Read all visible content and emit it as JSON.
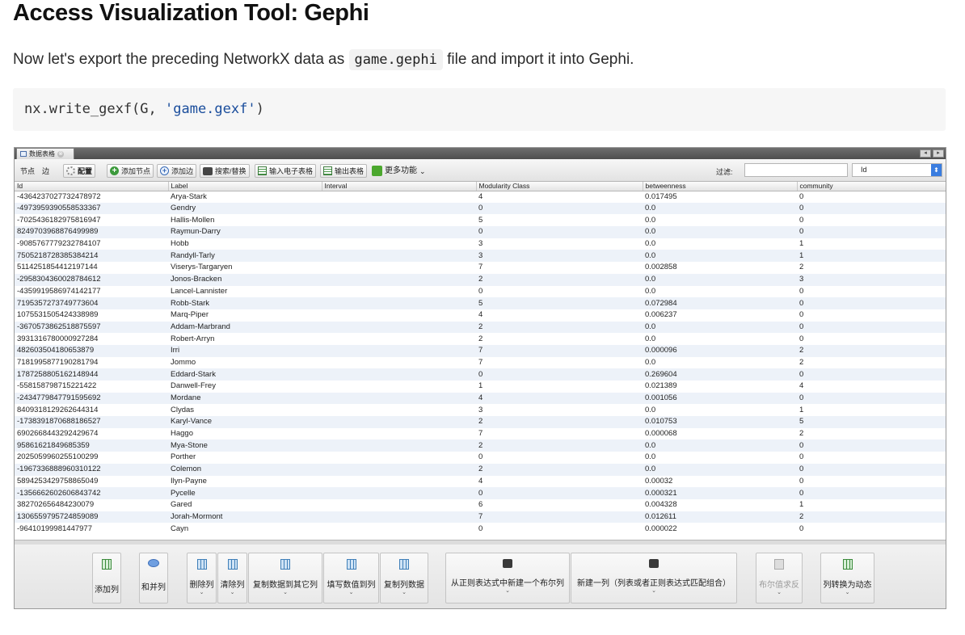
{
  "article": {
    "heading": "Access Visualization Tool: Gephi",
    "para_before": "Now let's export the preceding NetworkX data as",
    "para_code": "game.gephi",
    "para_after": "file and import it into Gephi.",
    "code_prefix": "nx.write_gexf(G, ",
    "code_string": "'game.gexf'",
    "code_suffix": ")"
  },
  "window": {
    "tab_title": "数据表格",
    "tab_close": "⊗",
    "ctrl_prev": "◂",
    "ctrl_next": "▸"
  },
  "toolbar": {
    "nodes": "节点",
    "edges": "边",
    "config": "配置",
    "add_node": "添加节点",
    "add_edge": "添加边",
    "search_replace": "搜索/替换",
    "import_sheet": "输入电子表格",
    "export_table": "输出表格",
    "more": "更多功能",
    "more_arrow": "⌄",
    "filter_label": "过滤:",
    "filter_value": "",
    "filter_column": "Id",
    "filter_arrow": "⬍"
  },
  "table": {
    "columns": [
      "Id",
      "Label",
      "Interval",
      "Modularity Class",
      "betweenness",
      "community"
    ],
    "rows": [
      [
        "-436423702773247897​2",
        "Arya-Stark",
        "",
        "4",
        "0.017495",
        "0"
      ],
      [
        "-4973959390558533367",
        "Gendry",
        "",
        "0",
        "0.0",
        "0"
      ],
      [
        "-7025436182975816947",
        "Hallis-Mollen",
        "",
        "5",
        "0.0",
        "0"
      ],
      [
        "8249703968876499989",
        "Raymun-Darry",
        "",
        "0",
        "0.0",
        "0"
      ],
      [
        "-9085767779232784107",
        "Hobb",
        "",
        "3",
        "0.0",
        "1"
      ],
      [
        "7505218728385384214",
        "Randyll-Tarly",
        "",
        "3",
        "0.0",
        "1"
      ],
      [
        "5114251854412197144",
        "Viserys-Targaryen",
        "",
        "7",
        "0.002858",
        "2"
      ],
      [
        "-2958304360028784612",
        "Jonos-Bracken",
        "",
        "2",
        "0.0",
        "3"
      ],
      [
        "-4359919586974142177",
        "Lancel-Lannister",
        "",
        "0",
        "0.0",
        "0"
      ],
      [
        "7195357273749773604",
        "Robb-Stark",
        "",
        "5",
        "0.072984",
        "0"
      ],
      [
        "1075531505424338989",
        "Marq-Piper",
        "",
        "4",
        "0.006237",
        "0"
      ],
      [
        "-3670573862518875597",
        "Addam-Marbrand",
        "",
        "2",
        "0.0",
        "0"
      ],
      [
        "3931316780000927284",
        "Robert-Arryn",
        "",
        "2",
        "0.0",
        "0"
      ],
      [
        "482603504180653879",
        "Irri",
        "",
        "7",
        "0.000096",
        "2"
      ],
      [
        "7181995877190281794",
        "Jommo",
        "",
        "7",
        "0.0",
        "2"
      ],
      [
        "1787258805162148944",
        "Eddard-Stark",
        "",
        "0",
        "0.269604",
        "0"
      ],
      [
        "-558158798715221422",
        "Danwell-Frey",
        "",
        "1",
        "0.021389",
        "4"
      ],
      [
        "-2434779847791595692",
        "Mordane",
        "",
        "4",
        "0.001056",
        "0"
      ],
      [
        "8409318129262644314",
        "Clydas",
        "",
        "3",
        "0.0",
        "1"
      ],
      [
        "-1738391870688186527",
        "Karyl-Vance",
        "",
        "2",
        "0.010753",
        "5"
      ],
      [
        "6902668443292429674",
        "Haggo",
        "",
        "7",
        "0.000068",
        "2"
      ],
      [
        "95861621849685359",
        "Mya-Stone",
        "",
        "2",
        "0.0",
        "0"
      ],
      [
        "2025059960255100299",
        "Porther",
        "",
        "0",
        "0.0",
        "0"
      ],
      [
        "-1967336888960310122",
        "Colemon",
        "",
        "2",
        "0.0",
        "0"
      ],
      [
        "5894253429758865049",
        "Ilyn-Payne",
        "",
        "4",
        "0.00032",
        "0"
      ],
      [
        "-1356662602606843742",
        "Pycelle",
        "",
        "0",
        "0.000321",
        "0"
      ],
      [
        "382702656484230079",
        "Gared",
        "",
        "6",
        "0.004328",
        "1"
      ],
      [
        "1306559795724859089",
        "Jorah-Mormont",
        "",
        "7",
        "0.012611",
        "2"
      ],
      [
        "-964101999814479​77",
        "Cayn",
        "",
        "0",
        "0.000022",
        "0"
      ]
    ]
  },
  "bottom_buttons": [
    {
      "label": "添加列",
      "arrow": ""
    },
    {
      "label": "和并列",
      "arrow": ""
    },
    {
      "label": "删除列",
      "arrow": "⌄"
    },
    {
      "label": "清除列",
      "arrow": "⌄"
    },
    {
      "label": "复制数据到其它列",
      "arrow": "⌄"
    },
    {
      "label": "填写数值到列",
      "arrow": "⌄"
    },
    {
      "label": "复制列数据",
      "arrow": "⌄"
    },
    {
      "label": "从正则表达式中新建一个布尔列",
      "arrow": "⌄"
    },
    {
      "label": "新建一列（列表或者正则表达式匹配组合）",
      "arrow": "⌄"
    },
    {
      "label": "布尔值求反",
      "arrow": "⌄"
    },
    {
      "label": "列转换为动态",
      "arrow": "⌄"
    }
  ]
}
